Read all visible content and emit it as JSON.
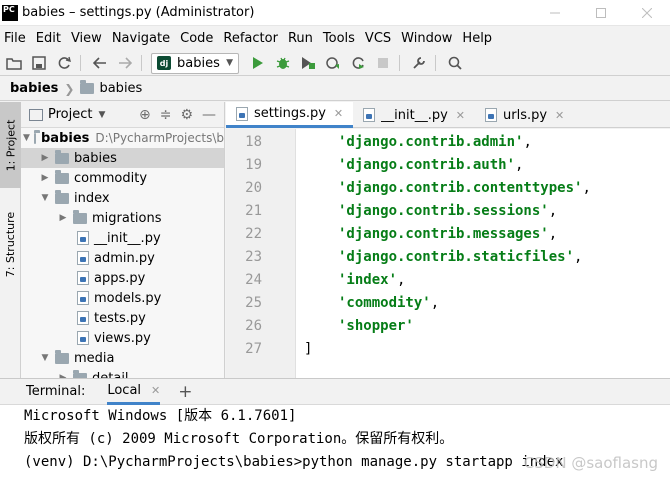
{
  "window": {
    "logo": "PC",
    "title": "babies – settings.py (Administrator)"
  },
  "menu": [
    "File",
    "Edit",
    "View",
    "Navigate",
    "Code",
    "Refactor",
    "Run",
    "Tools",
    "VCS",
    "Window",
    "Help"
  ],
  "toolbar": {
    "run_config": "babies",
    "run_config_icon": "dj",
    "icons": [
      "open-icon",
      "save-icon",
      "sync-icon",
      "back-icon",
      "forward-icon",
      "run-icon",
      "debug-icon",
      "coverage-icon",
      "profile-icon",
      "concurrency-icon",
      "stop-icon",
      "settings-wrench-icon",
      "search-icon"
    ],
    "accent_color": "#3c9b3c"
  },
  "breadcrumb": [
    "babies",
    "babies"
  ],
  "stripe": {
    "project_tab": "1: Project",
    "structure_tab": "7: Structure"
  },
  "project_panel": {
    "title": "Project",
    "root_name": "babies",
    "root_path": "D:\\PycharmProjects\\b",
    "items": [
      {
        "label": "babies",
        "kind": "folder"
      },
      {
        "label": "commodity",
        "kind": "folder"
      },
      {
        "label": "index",
        "kind": "folder"
      },
      {
        "label": "migrations",
        "kind": "folder"
      },
      {
        "label": "__init__.py",
        "kind": "py"
      },
      {
        "label": "admin.py",
        "kind": "py"
      },
      {
        "label": "apps.py",
        "kind": "py"
      },
      {
        "label": "models.py",
        "kind": "py"
      },
      {
        "label": "tests.py",
        "kind": "py"
      },
      {
        "label": "views.py",
        "kind": "py"
      },
      {
        "label": "media",
        "kind": "folder"
      },
      {
        "label": "detail",
        "kind": "folder"
      }
    ]
  },
  "editor": {
    "tabs": [
      {
        "label": "settings.py",
        "active": true
      },
      {
        "label": "__init__.py",
        "active": false
      },
      {
        "label": "urls.py",
        "active": false
      }
    ],
    "lines": [
      {
        "no": "18",
        "text": "'django.contrib.admin'",
        "tail": ","
      },
      {
        "no": "19",
        "text": "'django.contrib.auth'",
        "tail": ","
      },
      {
        "no": "20",
        "text": "'django.contrib.contenttypes'",
        "tail": ","
      },
      {
        "no": "21",
        "text": "'django.contrib.sessions'",
        "tail": ","
      },
      {
        "no": "22",
        "text": "'django.contrib.messages'",
        "tail": ","
      },
      {
        "no": "23",
        "text": "'django.contrib.staticfiles'",
        "tail": ","
      },
      {
        "no": "24",
        "text": "'index'",
        "tail": ","
      },
      {
        "no": "25",
        "text": "'commodity'",
        "tail": ","
      },
      {
        "no": "26",
        "text": "'shopper'",
        "tail": ""
      },
      {
        "no": "27",
        "text": "",
        "tail": "]"
      }
    ],
    "string_color": "#067d17"
  },
  "terminal": {
    "title": "Terminal:",
    "tab": "Local",
    "add": "+",
    "lines": [
      "Microsoft Windows [版本 6.1.7601]",
      "版权所有 (c) 2009 Microsoft Corporation。保留所有权利。",
      "(venv) D:\\PycharmProjects\\babies>python manage.py startapp index"
    ]
  },
  "watermark": "CSDN @saoflasng"
}
